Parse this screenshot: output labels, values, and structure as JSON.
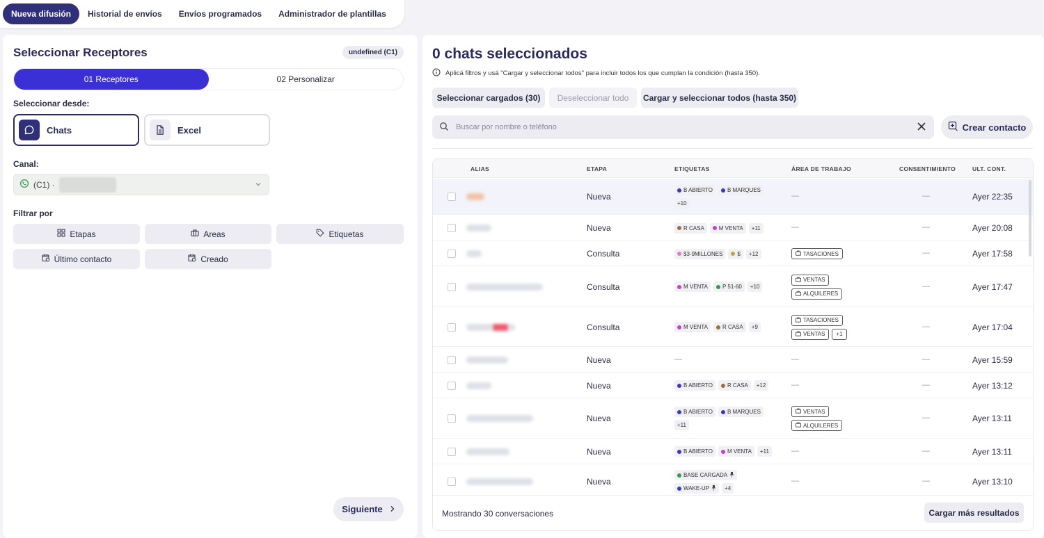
{
  "top_tabs": [
    "Nueva difusión",
    "Historial de envíos",
    "Envíos programados",
    "Administrador de plantillas"
  ],
  "left": {
    "title": "Seleccionar Receptores",
    "channel_badge": "undefined (C1)",
    "steps": [
      "01 Receptores",
      "02 Personalizar"
    ],
    "select_from_label": "Seleccionar desde:",
    "sources": [
      "Chats",
      "Excel"
    ],
    "canal_label": "Canal:",
    "canal_value": "(C1) · ",
    "filter_label": "Filtrar por",
    "filters": [
      "Etapas",
      "Areas",
      "Etiquetas",
      "Último contacto",
      "Creado"
    ],
    "next_label": "Siguiente"
  },
  "right": {
    "title": "0 chats seleccionados",
    "info": "Aplicá filtros y usá \"Cargar y seleccionar todos\" para incluir todos los que cumplan la condición (hasta 350).",
    "actions": [
      "Seleccionar cargados (30)",
      "Deseleccionar todo",
      "Cargar y seleccionar todos (hasta 350)"
    ],
    "search_placeholder": "Buscar por nombre o teléfono",
    "create_contact": "Crear contacto",
    "columns": [
      "ALIAS",
      "ETAPA",
      "ETIQUETAS",
      "ÁREA DE TRABAJO",
      "CONSENTIMIENTO",
      "ULT. CONT."
    ],
    "rows": [
      {
        "etapa": "Nueva",
        "tags": [
          {
            "t": "B ABIERTO",
            "c": "#3b35c9"
          },
          {
            "t": "B MARQUES",
            "c": "#3b35c9"
          },
          {
            "t": "+10"
          }
        ],
        "areas": [],
        "time": "Ayer 22:35"
      },
      {
        "etapa": "Nueva",
        "tags": [
          {
            "t": "R CASA",
            "c": "#a0703a"
          },
          {
            "t": "M VENTA",
            "c": "#c73fd1"
          },
          {
            "t": "+11"
          }
        ],
        "areas": [],
        "time": "Ayer 20:08"
      },
      {
        "etapa": "Consulta",
        "tags": [
          {
            "t": "$3-9MILLONES",
            "c": "#e07ad6"
          },
          {
            "t": "$",
            "c": "#c9a040"
          },
          {
            "t": "+12"
          }
        ],
        "areas": [
          [
            "TASACIONES"
          ]
        ],
        "time": "Ayer 17:58"
      },
      {
        "etapa": "Consulta",
        "tags": [
          {
            "t": "M VENTA",
            "c": "#c73fd1"
          },
          {
            "t": "P 51-60",
            "c": "#2e9d4f"
          },
          {
            "t": "+10"
          }
        ],
        "areas": [
          [
            "VENTAS"
          ],
          [
            "ALQUILERES"
          ]
        ],
        "time": "Ayer 17:47"
      },
      {
        "etapa": "Consulta",
        "tags": [
          {
            "t": "M VENTA",
            "c": "#c73fd1"
          },
          {
            "t": "R CASA",
            "c": "#a0703a"
          },
          {
            "t": "+9"
          }
        ],
        "areas": [
          [
            "TASACIONES"
          ],
          [
            "VENTAS",
            "+1"
          ]
        ],
        "time": "Ayer 17:04"
      },
      {
        "etapa": "Nueva",
        "tags": [],
        "areas": [],
        "time": "Ayer 15:59"
      },
      {
        "etapa": "Nueva",
        "tags": [
          {
            "t": "B ABIERTO",
            "c": "#3b35c9"
          },
          {
            "t": "R CASA",
            "c": "#a0703a"
          },
          {
            "t": "+12"
          }
        ],
        "areas": [],
        "time": "Ayer 13:12"
      },
      {
        "etapa": "Nueva",
        "tags": [
          {
            "t": "B ABIERTO",
            "c": "#3b35c9"
          },
          {
            "t": "B MARQUES",
            "c": "#3b35c9"
          },
          {
            "t": "+11"
          }
        ],
        "areas": [
          [
            "VENTAS"
          ],
          [
            "ALQUILERES"
          ]
        ],
        "time": "Ayer 13:11"
      },
      {
        "etapa": "Nueva",
        "tags": [
          {
            "t": "B ABIERTO",
            "c": "#3b35c9"
          },
          {
            "t": "M VENTA",
            "c": "#c73fd1"
          },
          {
            "t": "+11"
          }
        ],
        "areas": [],
        "time": "Ayer 13:11"
      },
      {
        "etapa": "Nueva",
        "tags": [
          {
            "t": "BASE CARGADA",
            "c": "#2e9d4f",
            "pin": true
          },
          {
            "t": "WAKE-UP",
            "c": "#2a3fc9",
            "pin": true
          },
          {
            "t": "+4"
          }
        ],
        "areas": [],
        "time": "Ayer 13:10"
      }
    ],
    "empty_mark": "—",
    "footer_count": "Mostrando 30 conversaciones",
    "load_more": "Cargar más resultados"
  }
}
